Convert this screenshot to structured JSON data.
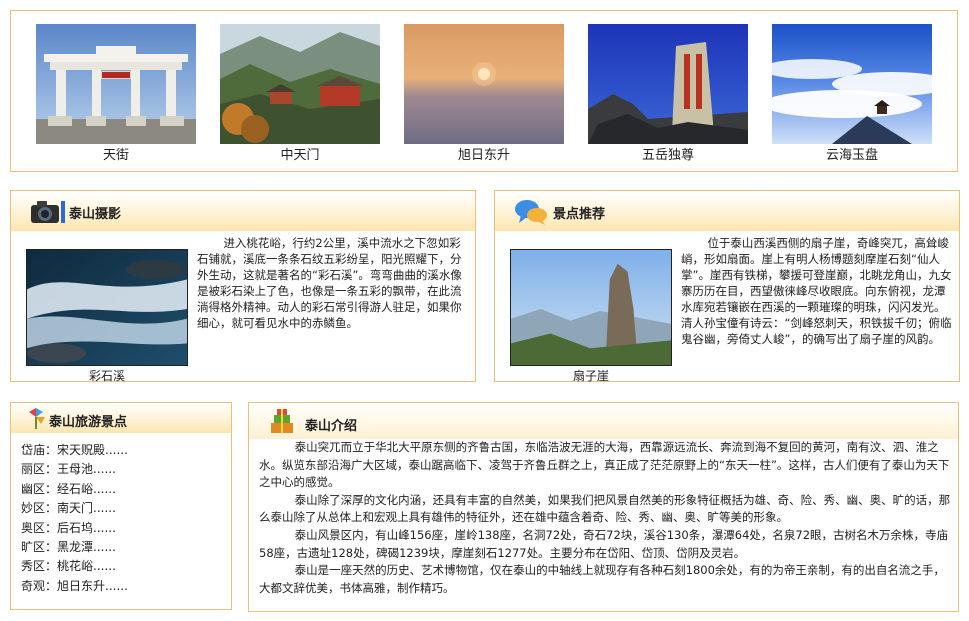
{
  "gallery": [
    {
      "caption": "天街",
      "icon": "memorial-archway-photo"
    },
    {
      "caption": "中天门",
      "icon": "mountain-temple-photo"
    },
    {
      "caption": "旭日东升",
      "icon": "sunrise-photo"
    },
    {
      "caption": "五岳独尊",
      "icon": "inscribed-rock-photo"
    },
    {
      "caption": "云海玉盘",
      "icon": "sea-of-clouds-photo"
    }
  ],
  "photography": {
    "title": "泰山摄影",
    "icon": "camera-icon",
    "photo_caption": "彩石溪",
    "text": "进入桃花峪，行约2公里，溪中流水之下忽如彩石铺就，溪底一条条石纹五彩纷呈，阳光照耀下，分外生动，这就是著名的“彩石溪”。弯弯曲曲的溪水像是被彩石染上了色，也像是一条五彩的飘带，在此流淌得格外精神。动人的彩石常引得游人驻足，如果你细心，就可看见水中的赤鳞鱼。"
  },
  "recommend": {
    "title": "景点推荐",
    "icon": "chat-bubbles-icon",
    "photo_caption": "扇子崖",
    "text": "位于泰山西溪西侧的扇子崖，奇峰突兀，高耸峻峭，形如扇面。崖上有明人杨博题刻摩崖石刻“仙人掌”。崖西有铁梯，攀援可登崖巅，北眺龙角山，九女寨历历在目，西望傲徕峰尽收眼底。向东俯视，龙潭水库宛若镶嵌在西溪的一颗璀璨的明珠，闪闪发光。清人孙宝僮有诗云：“剑峰怒刺天，积铁拔千仞；俯临鬼谷幽，旁倚丈人峻”，的确写出了扇子崖的风韵。"
  },
  "spots": {
    "title": "泰山旅游景点",
    "icon": "pinwheel-icon",
    "items": [
      {
        "region": "岱庙：",
        "name": "宋天贶殿......"
      },
      {
        "region": "丽区：",
        "name": "王母池......"
      },
      {
        "region": "幽区：",
        "name": "经石峪......"
      },
      {
        "region": "妙区：",
        "name": "南天门......"
      },
      {
        "region": "奥区：",
        "name": "后石坞......"
      },
      {
        "region": "旷区：",
        "name": "黑龙潭......"
      },
      {
        "region": "秀区：",
        "name": "桃花峪......"
      },
      {
        "region": "奇观：",
        "name": "旭日东升......"
      }
    ]
  },
  "intro": {
    "title": "泰山介绍",
    "icon": "gift-stack-icon",
    "paragraphs": [
      "泰山突兀而立于华北大平原东侧的齐鲁古国，东临浩波无涯的大海，西靠源远流长、奔流到海不复回的黄河，南有汶、泗、淮之水。纵览东部沿海广大区域，泰山踞高临下、凌驾于齐鲁丘群之上，真正成了茫茫原野上的“东天一柱”。这样，古人们便有了泰山为天下之中心的感觉。",
      "泰山除了深厚的文化内涵，还具有丰富的自然美，如果我们把风景自然美的形象特征概括为雄、奇、险、秀、幽、奥、旷的话，那么泰山除了从总体上和宏观上具有雄伟的特征外，还在雄中蕴含着奇、险、秀、幽、奥、旷等美的形象。",
      "泰山风景区内，有山峰156座，崖岭138座，名洞72处，奇石72块，溪谷130条，瀑潭64处，名泉72眼，古树名木万余株，寺庙58座，古遗址128处，碑碣1239块，摩崖刻石1277处。主要分布在岱阳、岱顶、岱阴及灵岩。",
      "泰山是一座天然的历史、艺术博物馆，仅在泰山的中轴线上就现存有各种石刻1800余处，有的为帝王亲制，有的出自名流之手，大都文辞优美，书体高雅，制作精巧。"
    ]
  },
  "colors": {
    "border": "#e3c27a",
    "header_gradient_end": "#fde5ad"
  }
}
